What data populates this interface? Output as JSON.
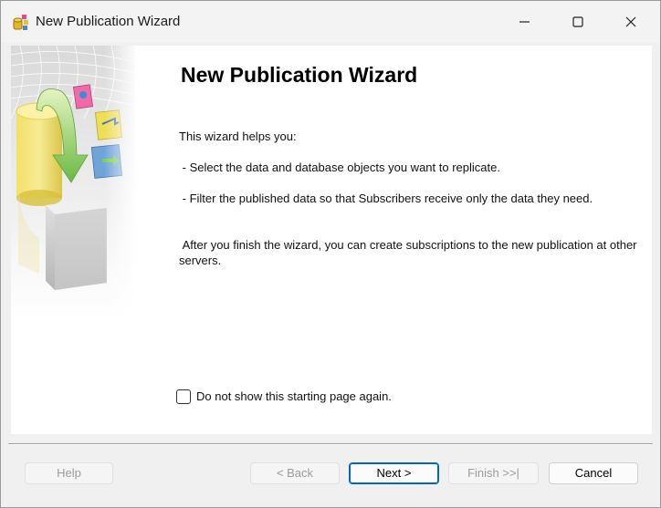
{
  "window": {
    "title": "New Publication Wizard"
  },
  "page": {
    "heading": "New Publication Wizard",
    "intro": "This wizard helps you:",
    "bullet_1": " - Select the data and database objects you want to replicate.",
    "bullet_2": " - Filter the published data so that Subscribers receive only the data they need.",
    "after": " After you finish the wizard, you can create subscriptions to the new publication at other servers.",
    "checkbox_label": "Do not show this starting page again.",
    "checkbox_checked": false
  },
  "buttons": {
    "help": "Help",
    "back": "< Back",
    "next": "Next >",
    "finish": "Finish >>|",
    "cancel": "Cancel"
  },
  "colors": {
    "accent": "#0067c0",
    "disabled_text": "#9c9c9c"
  },
  "icons": {
    "app": "publication-wizard-icon",
    "minimize": "minimize-icon",
    "maximize": "maximize-icon",
    "close": "close-icon",
    "banner": "wizard-banner-illustration"
  }
}
